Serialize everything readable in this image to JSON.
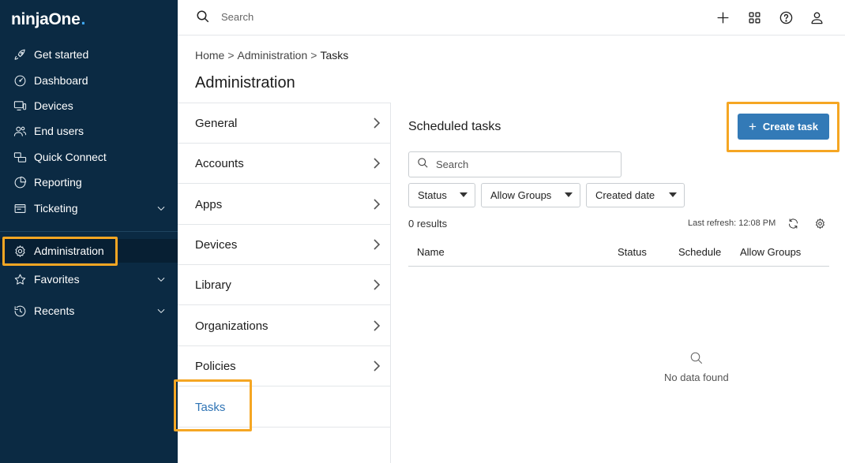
{
  "brand": {
    "logo_text": "ninjaOne",
    "logo_dot": ".",
    "accent": "#3fa9f5"
  },
  "sidebar": {
    "items": [
      {
        "label": "Get started",
        "icon": "rocket-icon"
      },
      {
        "label": "Dashboard",
        "icon": "gauge-icon"
      },
      {
        "label": "Devices",
        "icon": "devices-icon"
      },
      {
        "label": "End users",
        "icon": "users-icon"
      },
      {
        "label": "Quick Connect",
        "icon": "quick-connect-icon"
      },
      {
        "label": "Reporting",
        "icon": "pie-chart-icon"
      },
      {
        "label": "Ticketing",
        "icon": "ticket-icon",
        "expandable": true
      },
      {
        "label": "Administration",
        "icon": "gear-icon",
        "active": true
      },
      {
        "label": "Favorites",
        "icon": "star-icon",
        "expandable": true
      },
      {
        "label": "Recents",
        "icon": "history-icon",
        "expandable": true
      }
    ]
  },
  "topbar": {
    "search_placeholder": "Search",
    "icons": [
      "plus-icon",
      "grid-icon",
      "help-icon",
      "user-icon"
    ]
  },
  "breadcrumb": {
    "items": [
      "Home",
      "Administration",
      "Tasks"
    ],
    "separator": ">"
  },
  "page": {
    "title": "Administration"
  },
  "settings_list": {
    "items": [
      {
        "label": "General"
      },
      {
        "label": "Accounts"
      },
      {
        "label": "Apps"
      },
      {
        "label": "Devices"
      },
      {
        "label": "Library"
      },
      {
        "label": "Organizations"
      },
      {
        "label": "Policies"
      },
      {
        "label": "Tasks",
        "active": true
      }
    ]
  },
  "panel": {
    "title": "Scheduled tasks",
    "create_button": "Create task",
    "search_placeholder": "Search",
    "filters": [
      "Status",
      "Allow Groups",
      "Created date"
    ],
    "results": "0 results",
    "last_refresh": "Last refresh: 12:08 PM",
    "columns": [
      "Name",
      "Status",
      "Schedule",
      "Allow Groups"
    ],
    "empty_text": "No data found"
  },
  "colors": {
    "sidebar_bg": "#0b2a43",
    "primary_button": "#337ab7",
    "highlight": "#f5a623",
    "active_link": "#2f74b5"
  }
}
